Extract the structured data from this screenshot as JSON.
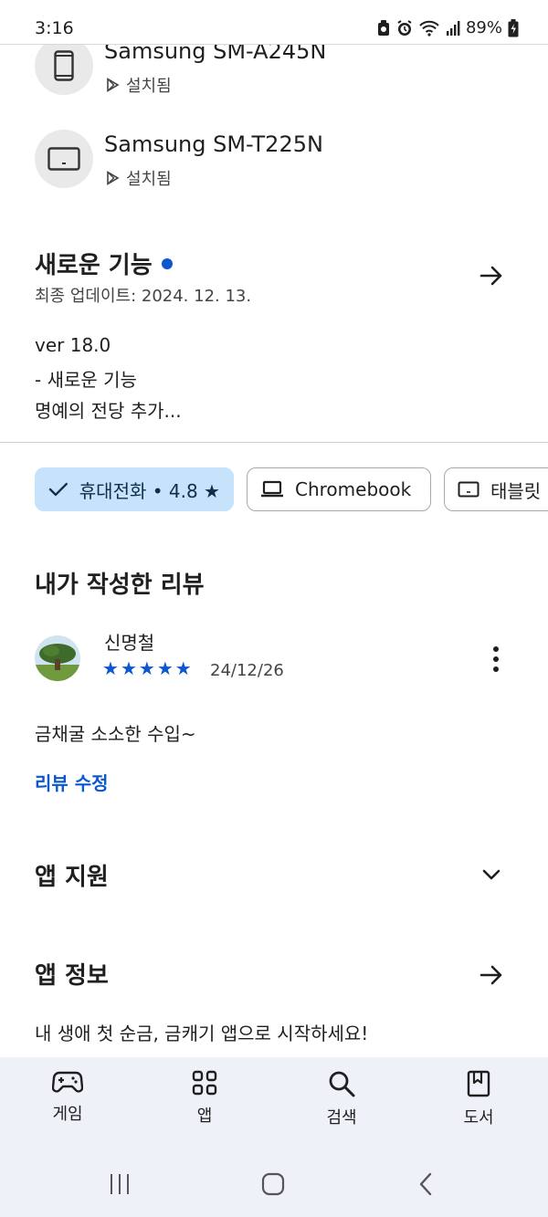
{
  "status_bar": {
    "time": "3:16",
    "battery": "89%"
  },
  "devices": [
    {
      "name": "Samsung SM-A245N",
      "status": "설치됨",
      "icon": "phone-icon"
    },
    {
      "name": "Samsung SM-T225N",
      "status": "설치됨",
      "icon": "tablet-icon"
    }
  ],
  "whats_new": {
    "title": "새로운 기능",
    "updated": "최종 업데이트: 2024. 12. 13.",
    "lines": [
      "ver 18.0",
      "- 새로운 기능",
      "명예의 전당 추가..."
    ]
  },
  "chips": [
    {
      "label": "휴대전화 • 4.8 ★",
      "icon": "check-icon",
      "selected": true
    },
    {
      "label": "Chromebook",
      "icon": "laptop-icon",
      "selected": false
    },
    {
      "label": "태블릿 •",
      "icon": "tablet-icon",
      "selected": false
    }
  ],
  "my_review": {
    "title": "내가 작성한 리뷰",
    "reviewer": "신명철",
    "rating": 5,
    "date": "24/12/26",
    "text": "금채굴 소소한 수입~",
    "edit_label": "리뷰 수정"
  },
  "app_support": {
    "title": "앱 지원"
  },
  "app_info": {
    "title": "앱 정보",
    "description": "내 생애 첫 순금, 금캐기 앱으로 시작하세요!"
  },
  "bottom_nav": [
    {
      "label": "게임",
      "icon": "gamepad-icon"
    },
    {
      "label": "앱",
      "icon": "apps-grid-icon"
    },
    {
      "label": "검색",
      "icon": "search-icon"
    },
    {
      "label": "도서",
      "icon": "book-icon"
    }
  ],
  "colors": {
    "accent": "#0b57d0",
    "chip_selected": "#c6e3fb",
    "nav_bg": "#eef1f7"
  }
}
